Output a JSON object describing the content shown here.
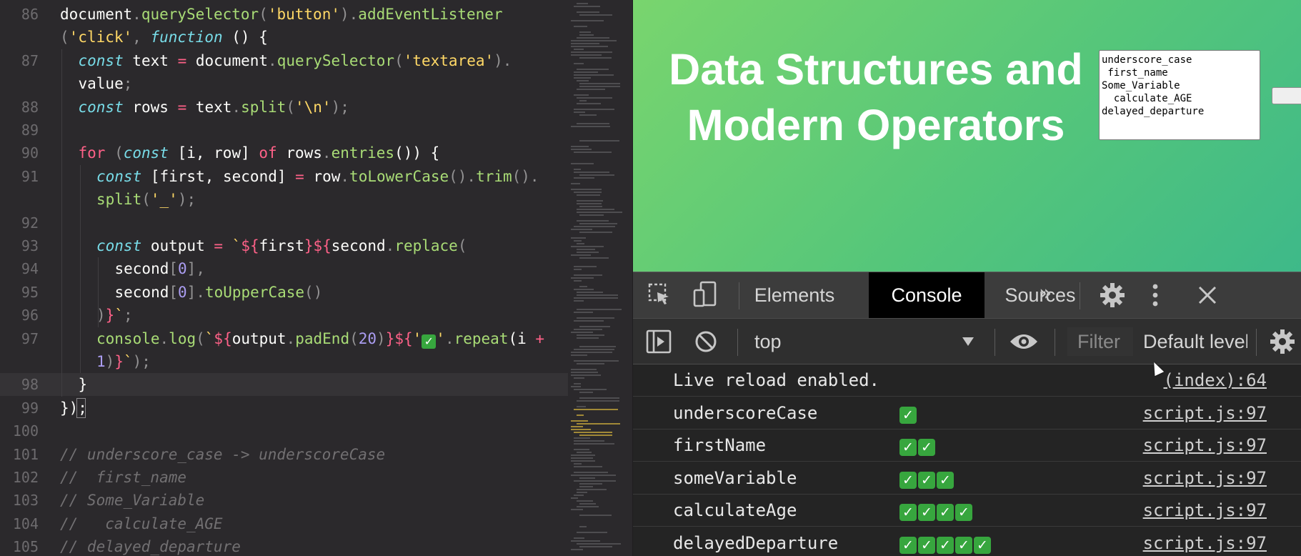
{
  "editor": {
    "lines": [
      {
        "num": "86",
        "tokens": [
          {
            "t": "document",
            "c": "plain"
          },
          {
            "t": ".",
            "c": "punc"
          },
          {
            "t": "querySelector",
            "c": "fn"
          },
          {
            "t": "(",
            "c": "punc"
          },
          {
            "t": "'button'",
            "c": "str"
          },
          {
            "t": ").",
            "c": "punc"
          },
          {
            "t": "addEventListener",
            "c": "fn"
          }
        ]
      },
      {
        "num": "",
        "tokens": [
          {
            "t": "(",
            "c": "punc"
          },
          {
            "t": "'click'",
            "c": "str"
          },
          {
            "t": ", ",
            "c": "punc"
          },
          {
            "t": "function",
            "c": "kw-i"
          },
          {
            "t": " () {",
            "c": "plain"
          }
        ]
      },
      {
        "num": "87",
        "tokens": [
          {
            "t": "const",
            "c": "kw-i"
          },
          {
            "t": " text ",
            "c": "plain"
          },
          {
            "t": "=",
            "c": "kw"
          },
          {
            "t": " document",
            "c": "plain"
          },
          {
            "t": ".",
            "c": "punc"
          },
          {
            "t": "querySelector",
            "c": "fn"
          },
          {
            "t": "(",
            "c": "punc"
          },
          {
            "t": "'textarea'",
            "c": "str"
          },
          {
            "t": ").",
            "c": "punc"
          }
        ]
      },
      {
        "num": "",
        "tokens": [
          {
            "t": "value",
            "c": "plain"
          },
          {
            "t": ";",
            "c": "punc"
          }
        ]
      },
      {
        "num": "88",
        "tokens": [
          {
            "t": "const",
            "c": "kw-i"
          },
          {
            "t": " rows ",
            "c": "plain"
          },
          {
            "t": "=",
            "c": "kw"
          },
          {
            "t": " text",
            "c": "plain"
          },
          {
            "t": ".",
            "c": "punc"
          },
          {
            "t": "split",
            "c": "fn"
          },
          {
            "t": "(",
            "c": "punc"
          },
          {
            "t": "'\\n'",
            "c": "str"
          },
          {
            "t": ");",
            "c": "punc"
          }
        ]
      },
      {
        "num": "89",
        "tokens": []
      },
      {
        "num": "90",
        "tokens": [
          {
            "t": "for",
            "c": "kw"
          },
          {
            "t": " (",
            "c": "punc"
          },
          {
            "t": "const",
            "c": "kw-i"
          },
          {
            "t": " [i, row] ",
            "c": "plain"
          },
          {
            "t": "of",
            "c": "kw"
          },
          {
            "t": " rows",
            "c": "plain"
          },
          {
            "t": ".",
            "c": "punc"
          },
          {
            "t": "entries",
            "c": "fn"
          },
          {
            "t": "()) {",
            "c": "plain"
          }
        ]
      },
      {
        "num": "91",
        "tokens": [
          {
            "t": "const",
            "c": "kw-i"
          },
          {
            "t": " [first, second] ",
            "c": "plain"
          },
          {
            "t": "=",
            "c": "kw"
          },
          {
            "t": " row",
            "c": "plain"
          },
          {
            "t": ".",
            "c": "punc"
          },
          {
            "t": "toLowerCase",
            "c": "fn"
          },
          {
            "t": "().",
            "c": "punc"
          },
          {
            "t": "trim",
            "c": "fn"
          },
          {
            "t": "().",
            "c": "punc"
          }
        ]
      },
      {
        "num": "",
        "tokens": [
          {
            "t": "split",
            "c": "fn"
          },
          {
            "t": "(",
            "c": "punc"
          },
          {
            "t": "'_'",
            "c": "str"
          },
          {
            "t": ");",
            "c": "punc"
          }
        ]
      },
      {
        "num": "92",
        "tokens": []
      },
      {
        "num": "93",
        "tokens": [
          {
            "t": "const",
            "c": "kw-i"
          },
          {
            "t": " output ",
            "c": "plain"
          },
          {
            "t": "=",
            "c": "kw"
          },
          {
            "t": " `",
            "c": "str"
          },
          {
            "t": "${",
            "c": "kw"
          },
          {
            "t": "first",
            "c": "plain"
          },
          {
            "t": "}${",
            "c": "kw"
          },
          {
            "t": "second",
            "c": "plain"
          },
          {
            "t": ".",
            "c": "punc"
          },
          {
            "t": "replace",
            "c": "fn"
          },
          {
            "t": "(",
            "c": "punc"
          }
        ]
      },
      {
        "num": "94",
        "tokens": [
          {
            "t": "second",
            "c": "plain"
          },
          {
            "t": "[",
            "c": "punc"
          },
          {
            "t": "0",
            "c": "num"
          },
          {
            "t": "],",
            "c": "punc"
          }
        ]
      },
      {
        "num": "95",
        "tokens": [
          {
            "t": "second",
            "c": "plain"
          },
          {
            "t": "[",
            "c": "punc"
          },
          {
            "t": "0",
            "c": "num"
          },
          {
            "t": "].",
            "c": "punc"
          },
          {
            "t": "toUpperCase",
            "c": "fn"
          },
          {
            "t": "()",
            "c": "punc"
          }
        ]
      },
      {
        "num": "96",
        "tokens": [
          {
            "t": ")",
            "c": "punc"
          },
          {
            "t": "}",
            "c": "kw"
          },
          {
            "t": "`",
            "c": "str"
          },
          {
            "t": ";",
            "c": "punc"
          }
        ]
      },
      {
        "num": "97",
        "tokens": [
          {
            "t": "console",
            "c": "fn"
          },
          {
            "t": ".",
            "c": "punc"
          },
          {
            "t": "log",
            "c": "fn"
          },
          {
            "t": "(",
            "c": "punc"
          },
          {
            "t": "`",
            "c": "str"
          },
          {
            "t": "${",
            "c": "kw"
          },
          {
            "t": "output",
            "c": "plain"
          },
          {
            "t": ".",
            "c": "punc"
          },
          {
            "t": "padEnd",
            "c": "fn"
          },
          {
            "t": "(",
            "c": "punc"
          },
          {
            "t": "20",
            "c": "num"
          },
          {
            "t": ")",
            "c": "punc"
          },
          {
            "t": "}${",
            "c": "kw"
          },
          {
            "t": "'",
            "c": "str"
          },
          {
            "t": "✓",
            "c": "check"
          },
          {
            "t": "'",
            "c": "str"
          },
          {
            "t": ".",
            "c": "punc"
          },
          {
            "t": "repeat",
            "c": "fn"
          },
          {
            "t": "(i ",
            "c": "plain"
          },
          {
            "t": "+",
            "c": "kw"
          }
        ]
      },
      {
        "num": "",
        "tokens": [
          {
            "t": "1",
            "c": "num"
          },
          {
            "t": ")",
            "c": "punc"
          },
          {
            "t": "}",
            "c": "kw"
          },
          {
            "t": "`",
            "c": "str"
          },
          {
            "t": ");",
            "c": "punc"
          }
        ]
      },
      {
        "num": "98",
        "tokens": [
          {
            "t": "}",
            "c": "plain"
          }
        ]
      },
      {
        "num": "99",
        "tokens": [
          {
            "t": "});",
            "c": "plain"
          }
        ]
      },
      {
        "num": "100",
        "tokens": []
      },
      {
        "num": "101",
        "tokens": [
          {
            "t": "// underscore_case -> underscoreCase",
            "c": "cmt"
          }
        ]
      },
      {
        "num": "102",
        "tokens": [
          {
            "t": "//  first_name",
            "c": "cmt"
          }
        ]
      },
      {
        "num": "103",
        "tokens": [
          {
            "t": "// Some_Variable",
            "c": "cmt"
          }
        ]
      },
      {
        "num": "104",
        "tokens": [
          {
            "t": "//   calculate_AGE",
            "c": "cmt"
          }
        ]
      },
      {
        "num": "105",
        "tokens": [
          {
            "t": "// delayed_departure",
            "c": "cmt"
          }
        ]
      }
    ]
  },
  "page": {
    "title": "Data Structures and\nModern Operators",
    "textarea_value": "underscore_case\n first_name\nSome_Variable\n  calculate_AGE\ndelayed_departure"
  },
  "devtools": {
    "tabs": [
      {
        "label": "Elements",
        "active": false
      },
      {
        "label": "Console",
        "active": true
      },
      {
        "label": "Sources",
        "active": false
      }
    ],
    "more_tabs_icon": "»",
    "icons": {
      "inspect": "inspect-element-icon",
      "device": "device-toolbar-icon",
      "settings": "gear-icon",
      "menu": "kebab-menu-icon",
      "close": "close-icon",
      "sidebar": "console-sidebar-icon",
      "clear": "clear-console-icon",
      "eye": "live-expression-icon"
    },
    "context": "top",
    "filter_placeholder": "Filter",
    "level_select": "Default levels",
    "console": [
      {
        "message": "Live reload enabled.",
        "checks": 0,
        "source": "(index):64"
      },
      {
        "message": "underscoreCase",
        "checks": 1,
        "source": "script.js:97"
      },
      {
        "message": "firstName",
        "checks": 2,
        "source": "script.js:97"
      },
      {
        "message": "someVariable",
        "checks": 3,
        "source": "script.js:97"
      },
      {
        "message": "calculateAge",
        "checks": 4,
        "source": "script.js:97"
      },
      {
        "message": "delayedDeparture",
        "checks": 5,
        "source": "script.js:97"
      }
    ]
  },
  "colors": {
    "editor_bg": "#2b292c",
    "accent_green": "#55c67a",
    "check_green": "#37a63e"
  }
}
